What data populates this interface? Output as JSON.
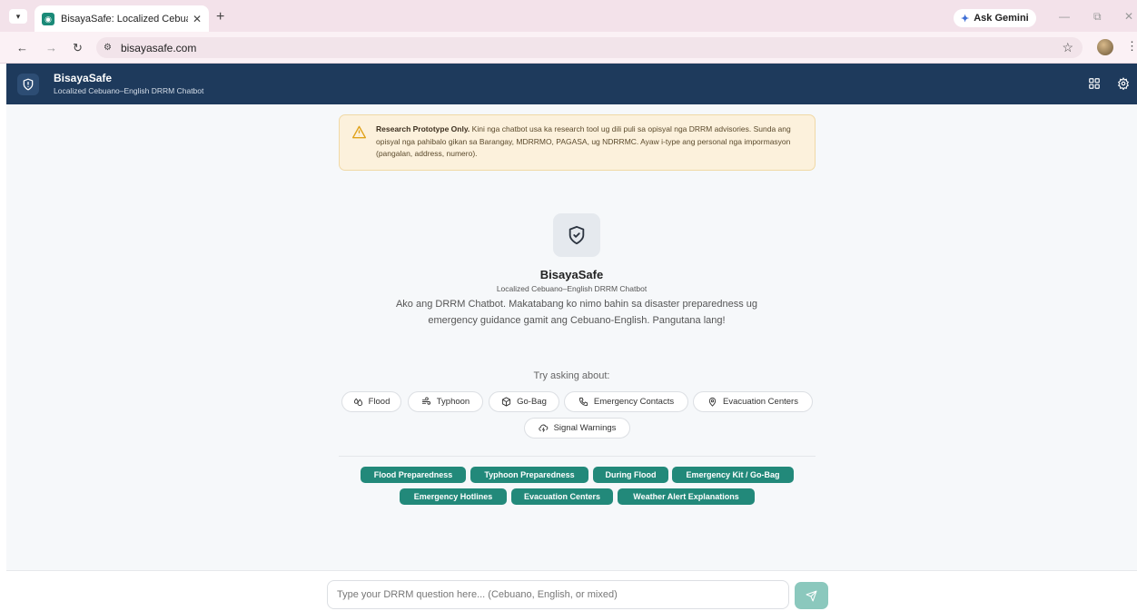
{
  "browser": {
    "tab_title": "BisayaSafe: Localized Cebuano-",
    "url": "bisayasafe.com",
    "gemini_label": "Ask Gemini"
  },
  "header": {
    "app_name": "BisayaSafe",
    "app_subtitle": "Localized Cebuano–English DRRM Chatbot"
  },
  "warning": {
    "title": "Research Prototype Only.",
    "body": "Kini nga chatbot usa ka research tool ug dili puli sa opisyal nga DRRM advisories. Sunda ang opisyal nga pahibalo gikan sa Barangay, MDRRMO, PAGASA, ug NDRRMC. Ayaw i-type ang personal nga impormasyon (pangalan, address, numero)."
  },
  "hero": {
    "title": "BisayaSafe",
    "subtitle": "Localized Cebuano–English DRRM Chatbot",
    "intro": "Ako ang DRRM Chatbot. Makatabang ko nimo bahin sa disaster preparedness ug emergency guidance gamit ang Cebuano-English. Pangutana lang!",
    "try_label": "Try asking about:"
  },
  "topics": [
    {
      "label": "Flood",
      "icon": "droplets-icon"
    },
    {
      "label": "Typhoon",
      "icon": "wind-icon"
    },
    {
      "label": "Go-Bag",
      "icon": "package-icon"
    },
    {
      "label": "Emergency Contacts",
      "icon": "phone-icon"
    },
    {
      "label": "Evacuation Centers",
      "icon": "map-pin-icon"
    },
    {
      "label": "Signal Warnings",
      "icon": "cloud-lightning-icon"
    }
  ],
  "quick_replies": [
    "Flood Preparedness",
    "Typhoon Preparedness",
    "During Flood",
    "Emergency Kit / Go-Bag",
    "Emergency Hotlines",
    "Evacuation Centers",
    "Weather Alert Explanations"
  ],
  "input": {
    "placeholder": "Type your DRRM question here... (Cebuano, English, or mixed)",
    "value": ""
  },
  "colors": {
    "header_bg": "#1e3a5c",
    "accent": "#22897a",
    "warning_bg": "#fcf1dc"
  }
}
